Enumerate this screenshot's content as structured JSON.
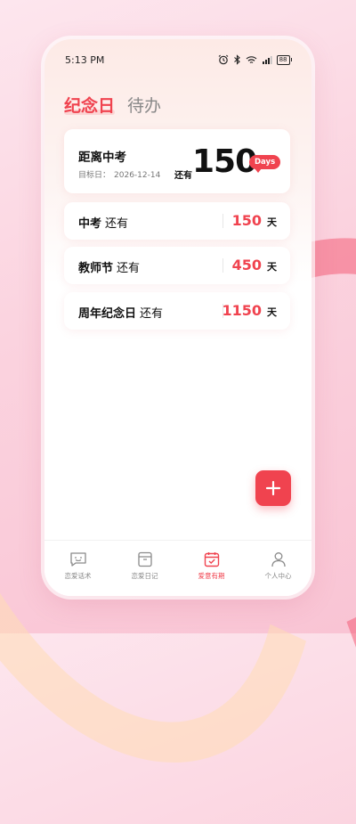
{
  "status_bar": {
    "time": "5:13 PM",
    "battery": "88"
  },
  "tabs": [
    {
      "label": "纪念日",
      "active": true
    },
    {
      "label": "待办",
      "active": false
    }
  ],
  "main_card": {
    "title": "距离中考",
    "target_label": "目标日：",
    "target_date": "2026-12-14",
    "prefix": "还有",
    "days": "150",
    "badge": "Days"
  },
  "rows": [
    {
      "name": "中考",
      "suffix": "还有",
      "value": "150",
      "unit": "天"
    },
    {
      "name": "教师节",
      "suffix": "还有",
      "value": "450",
      "unit": "天"
    },
    {
      "name": "周年纪念日",
      "suffix": "还有",
      "value": "1150",
      "unit": "天"
    }
  ],
  "fab": {
    "icon": "plus-icon"
  },
  "nav": [
    {
      "label": "恋爱话术",
      "icon": "chat-smile-icon",
      "active": false
    },
    {
      "label": "恋爱日记",
      "icon": "diary-box-icon",
      "active": false
    },
    {
      "label": "爱意有期",
      "icon": "calendar-check-icon",
      "active": true
    },
    {
      "label": "个人中心",
      "icon": "person-icon",
      "active": false
    }
  ],
  "colors": {
    "accent": "#f0434f",
    "text": "#111111",
    "muted": "#888888"
  }
}
